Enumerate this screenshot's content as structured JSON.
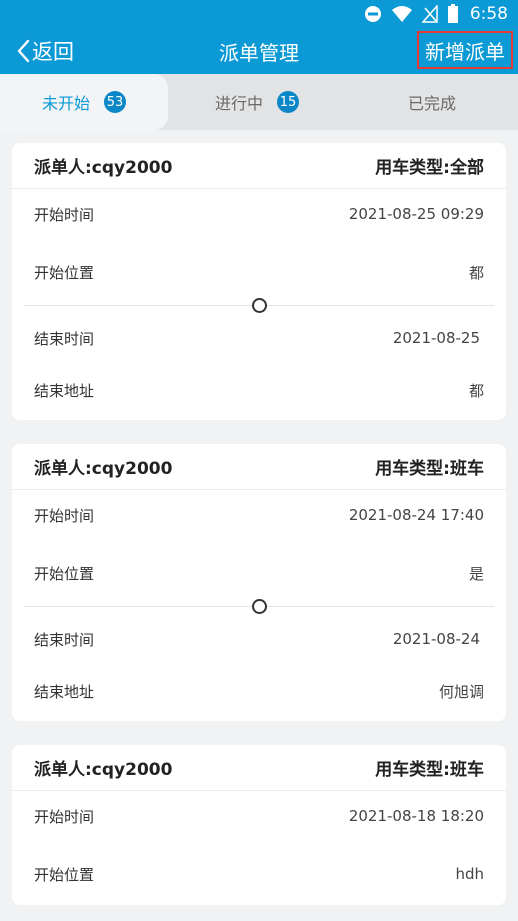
{
  "status_bar": {
    "time": "6:58",
    "icons": [
      "do-not-disturb-icon",
      "wifi-icon",
      "no-signal-icon",
      "battery-icon"
    ]
  },
  "nav": {
    "back_label": "返回",
    "title": "派单管理",
    "new_label": "新增派单"
  },
  "tabs": [
    {
      "label": "未开始",
      "badge": "53",
      "active": true
    },
    {
      "label": "进行中",
      "badge": "15",
      "active": false
    },
    {
      "label": "已完成",
      "badge": "",
      "active": false
    }
  ],
  "labels": {
    "start_time": "开始时间",
    "start_location": "开始位置",
    "end_time": "结束时间",
    "end_address": "结束地址"
  },
  "orders": [
    {
      "dispatcher": "派单人:cqy2000",
      "vehicle_type": "用车类型:全部",
      "start_time": "2021-08-25 09:29",
      "start_location": "都",
      "end_time": "2021-08-25",
      "end_address": "都"
    },
    {
      "dispatcher": "派单人:cqy2000",
      "vehicle_type": "用车类型:班车",
      "start_time": "2021-08-24 17:40",
      "start_location": "是",
      "end_time": "2021-08-24",
      "end_address": "何旭调"
    },
    {
      "dispatcher": "派单人:cqy2000",
      "vehicle_type": "用车类型:班车",
      "start_time": "2021-08-18 18:20",
      "start_location": "hdh"
    }
  ],
  "colors": {
    "primary": "#0b9ad6",
    "badge": "#0b86c7",
    "highlight_border": "#e53935"
  }
}
